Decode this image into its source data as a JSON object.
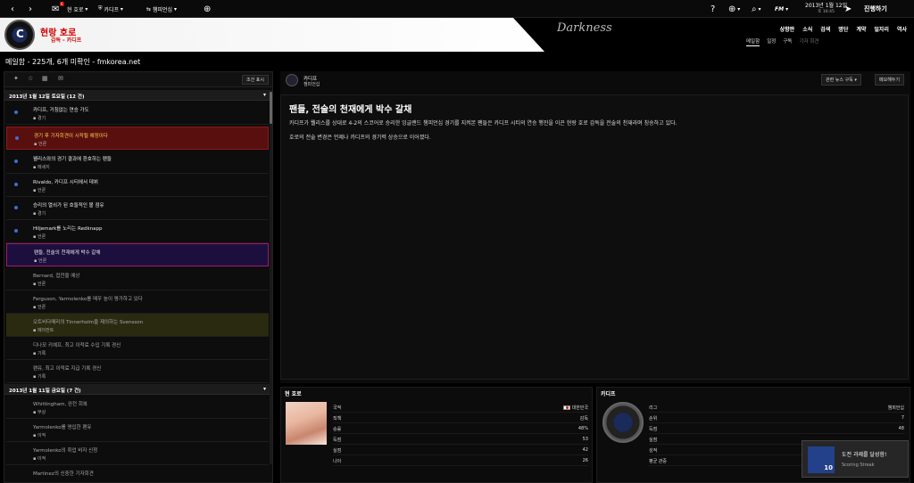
{
  "topbar": {
    "back": "‹",
    "forward": "›",
    "inbox_badge": "6",
    "manager": "현 호로",
    "club": "카디프",
    "competition": "챔피언십",
    "help": "?",
    "fm_label": "FM",
    "date": "2013년 1월 12일",
    "time": "토 16:45",
    "continue": "진행하기"
  },
  "header": {
    "manager_name": "현랑 호로",
    "manager_sub": "감독 - 카디프",
    "skin_name": "Darkness",
    "nav": [
      "상향판",
      "소식",
      "검색",
      "명단",
      "계약",
      "일자리",
      "역사"
    ],
    "subnav": [
      "메일함",
      "일정",
      "구독",
      "기자 회견"
    ]
  },
  "page_title": "메일함 - 225개, 6개 미확인 - fmkorea.net",
  "left": {
    "filter_label": "조건 표시",
    "groups": [
      {
        "header": "2013년 1월 12일 토요일 (12 건)"
      },
      {
        "header": "2013년 1월 11일 금요일 (7 건)"
      }
    ],
    "items": [
      {
        "title": "카디프, 거침없는 연승 가도",
        "category": "경기"
      },
      {
        "title": "경기 후 기자회견이 시작될 예정이다",
        "category": "언론"
      },
      {
        "title": "웰리스와의 경기 결과에 환호하는 팬들",
        "category": "메세지"
      },
      {
        "title": "Rivaldo, 카디프 시티에서 데뷔",
        "category": "언론"
      },
      {
        "title": "승리의 열쇠가 된 호들적인 볼 점유",
        "category": "경기"
      },
      {
        "title": "Hiljemark를 노리는 Redknapp",
        "category": "언론"
      },
      {
        "title": "팬들, 전술의 천재에게 박수 갈채",
        "category": "언론"
      },
      {
        "title": "Bernard, 접전을 예상",
        "category": "언론"
      },
      {
        "title": "Ferguson, Yarmolenko를 매우 높이 평가하고 있다",
        "category": "언론"
      },
      {
        "title": "오트비다메리의 Tinnerholm을 제의하는 Svensson",
        "category": "에이전트"
      },
      {
        "title": "디나모 키예프, 최고 이적료 수입 기록 경신",
        "category": "기록"
      },
      {
        "title": "팬유, 최고 이적료 지급 기록 경신",
        "category": "기록"
      },
      {
        "title": "Whittingham, 완전 회복",
        "category": "부상"
      },
      {
        "title": "Yarmolenko를 영입한 팬유",
        "category": "이적"
      },
      {
        "title": "Yarmolenko의 취업 비자 신청",
        "category": "이적"
      },
      {
        "title": "Martinez의 신중한 기자회견",
        "category": ""
      }
    ]
  },
  "right": {
    "sender": "카디프",
    "competition": "챔피언십",
    "related_btn": "관련 뉴스 구독 ▾",
    "memo_btn": "메모해두기",
    "headline": "팬들, 전술의 천재에게 박수 갈채",
    "paragraphs": [
      "카디프가 웰리스를 상대로 4-2의 스코어로 승리한 잉글랜드 챔피언십 경기를 지켜본 팬들은 카디프 시티의 연승 행진을 이끈 현랑 호로 감독을 전술의 천재라며 칭송하고 있다.",
      "호로의 전술 변경은 언제나 카디프의 경기력 상승으로 이어졌다."
    ]
  },
  "manager_card": {
    "title": "현 호로",
    "rows": [
      {
        "label": "국적",
        "value": "대한민국"
      },
      {
        "label": "직책",
        "value": "감독"
      },
      {
        "label": "승률",
        "value": "48%"
      },
      {
        "label": "득점",
        "value": "53"
      },
      {
        "label": "실점",
        "value": "42"
      },
      {
        "label": "나이",
        "value": "26"
      }
    ]
  },
  "club_card": {
    "title": "카디프",
    "rows": [
      {
        "label": "리그",
        "value": "챔피언십"
      },
      {
        "label": "순위",
        "value": "7"
      },
      {
        "label": "득점",
        "value": "48"
      },
      {
        "label": "실점",
        "value": ""
      },
      {
        "label": "성적",
        "value": ""
      },
      {
        "label": "평균 관중",
        "value": ""
      }
    ]
  },
  "achievement": {
    "title": "도전 과제를 달성함!",
    "subtitle": "Scoring Streak",
    "count": "10"
  },
  "colors": {
    "unread_dot": "#3d6fd8",
    "red_item": "#5a0f0f",
    "selected_border": "#a3186e",
    "manager_red": "#d40000"
  }
}
